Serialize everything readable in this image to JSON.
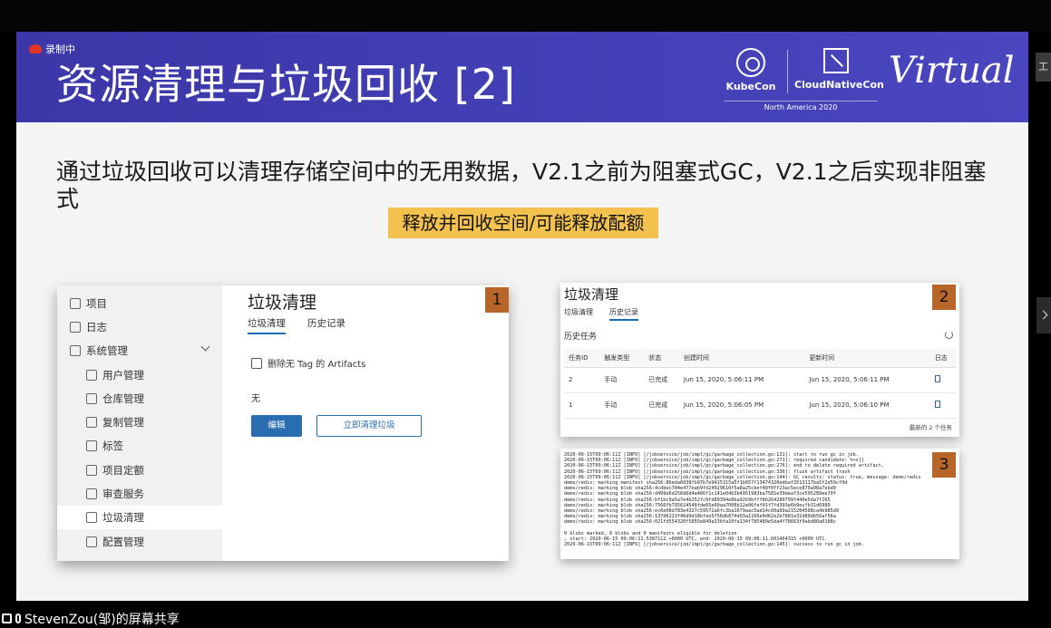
{
  "recording": {
    "label": "录制中"
  },
  "slide": {
    "title": "资源清理与垃圾回收 [2]",
    "description": "通过垃圾回收可以清理存储空间中的无用数据，V2.1之前为阻塞式GC，V2.1之后实现非阻塞式",
    "highlight": "释放并回收空间/可能释放配额",
    "logos": {
      "kubecon": "KubeCon",
      "cncf": "CloudNativeCon",
      "region": "North America 2020",
      "virtual": "Virtual"
    }
  },
  "panel1": {
    "badge": "1",
    "nav": [
      {
        "label": "项目",
        "icon": "projects-icon"
      },
      {
        "label": "日志",
        "icon": "logs-icon"
      },
      {
        "label": "系统管理",
        "icon": "admin-icon"
      },
      {
        "label": "用户管理",
        "icon": "users-icon"
      },
      {
        "label": "仓库管理",
        "icon": "registry-icon"
      },
      {
        "label": "复制管理",
        "icon": "replication-icon"
      },
      {
        "label": "标签",
        "icon": "tag-icon"
      },
      {
        "label": "项目定额",
        "icon": "quota-icon"
      },
      {
        "label": "审查服务",
        "icon": "shield-icon"
      },
      {
        "label": "垃圾清理",
        "icon": "trash-icon"
      },
      {
        "label": "配置管理",
        "icon": "gear-icon"
      }
    ],
    "title": "垃圾清理",
    "tabs": [
      "垃圾清理",
      "历史记录"
    ],
    "checkbox_label": "删除无 Tag 的 Artifacts",
    "schedule_value": "无",
    "edit_button": "编辑",
    "gc_now_button": "立即清理垃圾"
  },
  "panel2": {
    "badge": "2",
    "title": "垃圾清理",
    "tabs": [
      "垃圾清理",
      "历史记录"
    ],
    "subtitle": "历史任务",
    "columns": [
      "任务ID",
      "触发类型",
      "状态",
      "创建时间",
      "更新时间",
      "日志"
    ],
    "rows": [
      [
        "2",
        "手动",
        "已完成",
        "Jun 15, 2020, 5:06:11 PM",
        "Jun 15, 2020, 5:06:11 PM"
      ],
      [
        "1",
        "手动",
        "已完成",
        "Jun 15, 2020, 5:06:05 PM",
        "Jun 15, 2020, 5:06:10 PM"
      ]
    ],
    "footer": "最新的 2 个任务"
  },
  "panel3": {
    "badge": "3",
    "log": "2020-06-15T09:06:11Z [INFO] [/jobservice/job/impl/gc/garbage_collection.go:131]: start to run gc in job.\n2020-06-15T09:06:11Z [INFO] [/jobservice/job/impl/gc/garbage_collection.go:271]: required candidate: %+v[]\n2020-06-15T09:06:11Z [INFO] [/jobservice/job/impl/gc/garbage_collection.go:276]: end to delete required artifact.\n2020-06-15T09:06:11Z [INFO] [/jobservice/job/impl/gc/garbage_collection.go:336]: flush artifact trash\n2020-06-15T09:06:11Z [INFO] [/jobservice/job/impl/gc/garbage_collection.go:144]: GC results: status: true, message: demo/redis\ndemo/redis: marking manifest sha256:86eda6038fb97b7e9415315a5f1b657f13474326edbaf3513117ba5f2d59cf9d\ndemo/redis: marking blob sha256:4cdbec704e477eab9fd24929610f5a8a25cbef48f0ff23ac5ece879a98a7ebd0\ndemo/redis: marking blob sha256:d499e6d256d6d4a466f1c141e04b3b4951983ba7581e39deaf3ce595289ee70f\ndemo/redis: marking blob sha256:bf1bc9a5a7e4b252fc9fd89394e8ba92b9bfff8b264280799f440e5da7f265\ndemo/redis: marking blob sha256:7566fb795624548fde65e60aa7008b12e06fef01f7fd393e6b9ecfb31d6989\ndemo/redis: marking blob sha256:ec6e08d783e4327c59572a6fc3ba1679aac5ad14c60a89a215204508ca4b985d9\ndemo/redis: marking blob sha256:137d6223f46d9d18bfee5f56db874d03a1166e0d62e2b7881e32d80db56af56a\ndemo/redis: marking blob sha256:021fd554320f5855e849a330fa10fa134f785489e5da4f78663f9abd80a0188c\n\n0 blobs marked, 0 blobs and 0 manifests eligible for deletion\n, start: 2020-06-15 09:06:11.5387112 +0000 UTC, end: 2020-06-15 09:06:11.601464315 +0000 UTC.\n2020-06-15T09:06:11Z [INFO] [/jobservice/job/impl/gc/garbage_collection.go:145]: success to run gc in job."
  },
  "side_tab": "工",
  "share_bar": {
    "label": "StevenZou(邹)的屏幕共享"
  }
}
